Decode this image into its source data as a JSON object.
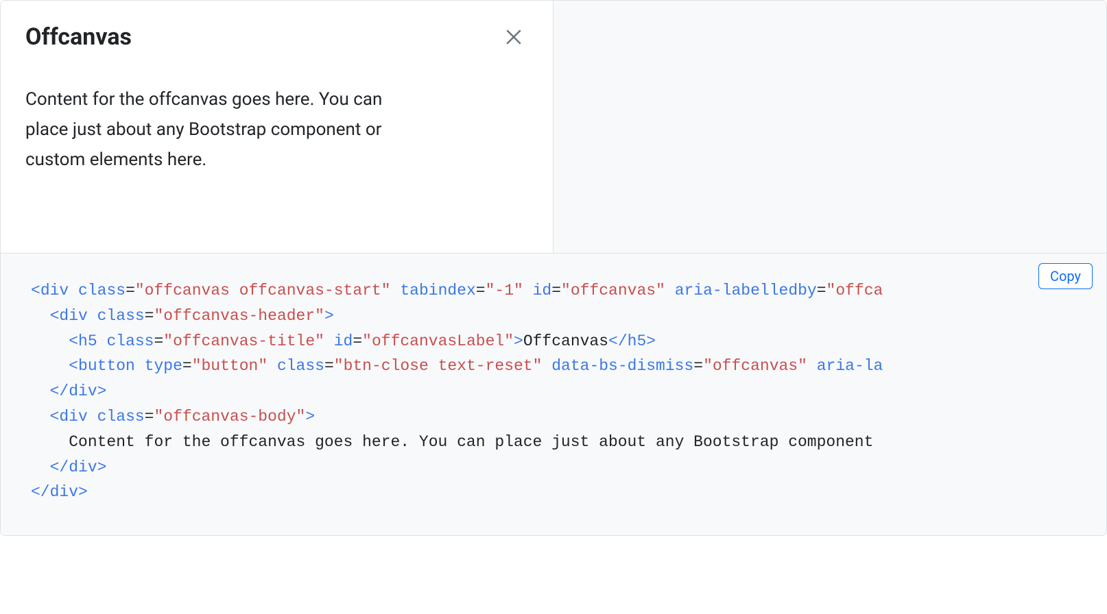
{
  "offcanvas": {
    "title": "Offcanvas",
    "body": "Content for the offcanvas goes here. You can place just about any Bootstrap component or custom elements here."
  },
  "copy_label": "Copy",
  "code": {
    "line1": {
      "tag_open": "<",
      "tag": "div",
      "sp1": " ",
      "attr1": "class",
      "eq": "=",
      "val1": "\"offcanvas offcanvas-start\"",
      "sp2": " ",
      "attr2": "tabindex",
      "val2": "\"-1\"",
      "sp3": " ",
      "attr3": "id",
      "val3": "\"offcanvas\"",
      "sp4": " ",
      "attr4": "aria-labelledby",
      "val4": "\"offca",
      "tag_close": ""
    },
    "line2": {
      "indent": "  ",
      "tag_open": "<",
      "tag": "div",
      "sp1": " ",
      "attr1": "class",
      "eq": "=",
      "val1": "\"offcanvas-header\"",
      "tag_close": ">"
    },
    "line3": {
      "indent": "    ",
      "tag_open": "<",
      "tag": "h5",
      "sp1": " ",
      "attr1": "class",
      "eq": "=",
      "val1": "\"offcanvas-title\"",
      "sp2": " ",
      "attr2": "id",
      "val2": "\"offcanvasLabel\"",
      "tag_close": ">",
      "text": "Offcanvas",
      "close_open": "</",
      "close_tag": "h5",
      "close_close": ">"
    },
    "line4": {
      "indent": "    ",
      "tag_open": "<",
      "tag": "button",
      "sp1": " ",
      "attr1": "type",
      "eq": "=",
      "val1": "\"button\"",
      "sp2": " ",
      "attr2": "class",
      "val2": "\"btn-close text-reset\"",
      "sp3": " ",
      "attr3": "data-bs-dismiss",
      "val3": "\"offcanvas\"",
      "sp4": " ",
      "attr4": "aria-la"
    },
    "line5": {
      "indent": "  ",
      "close_open": "</",
      "close_tag": "div",
      "close_close": ">"
    },
    "line6": {
      "indent": "  ",
      "tag_open": "<",
      "tag": "div",
      "sp1": " ",
      "attr1": "class",
      "eq": "=",
      "val1": "\"offcanvas-body\"",
      "tag_close": ">"
    },
    "line7": {
      "indent": "    ",
      "text": "Content for the offcanvas goes here. You can place just about any Bootstrap component "
    },
    "line8": {
      "indent": "  ",
      "close_open": "</",
      "close_tag": "div",
      "close_close": ">"
    },
    "line9": {
      "close_open": "</",
      "close_tag": "div",
      "close_close": ">"
    }
  }
}
